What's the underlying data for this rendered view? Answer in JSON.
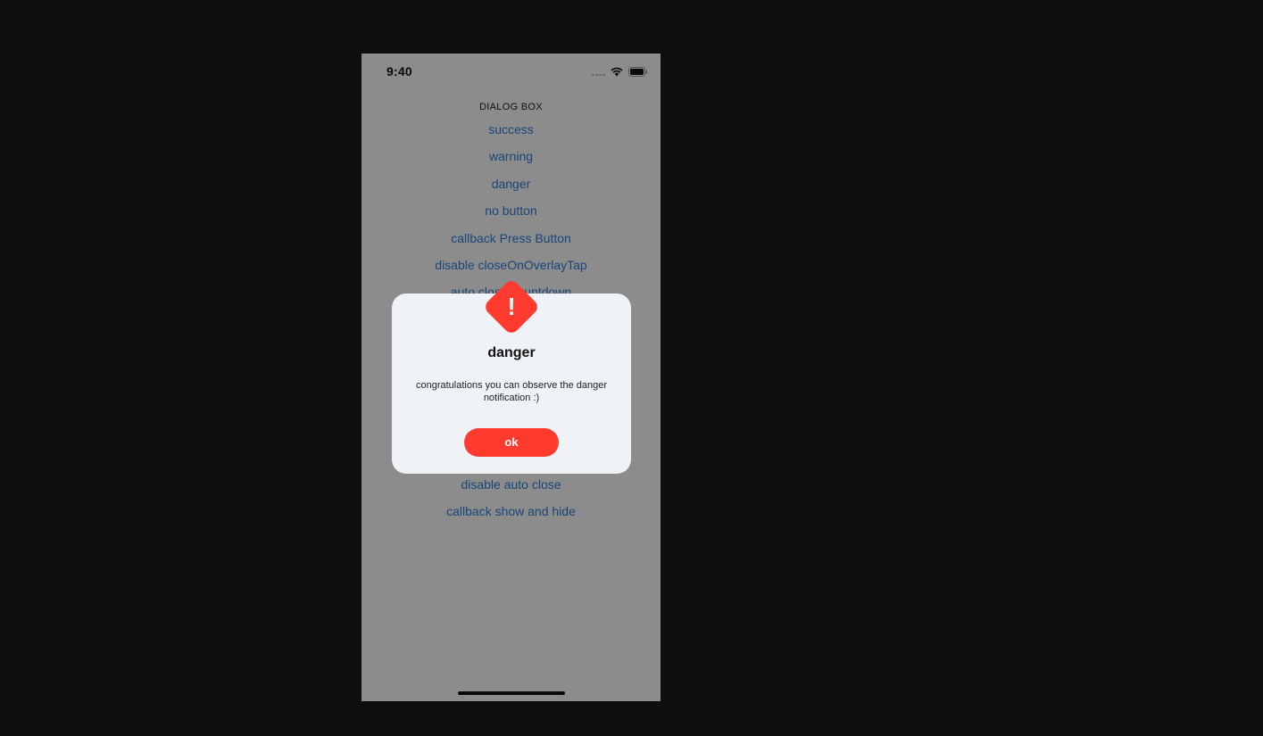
{
  "status_bar": {
    "time": "9:40",
    "icons": [
      "signal-icon",
      "wifi-icon",
      "battery-icon"
    ]
  },
  "screen": {
    "section_title": "DIALOG BOX",
    "menu_items_top": [
      "success",
      "warning",
      "danger",
      "no button",
      "callback Press Button",
      "disable closeOnOverlayTap",
      "auto close countdown"
    ],
    "menu_items_bottom": [
      "disable auto close",
      "callback show and hide"
    ],
    "link_color": "#2f7fdb"
  },
  "dialog": {
    "icon": "exclamation-diamond-icon",
    "icon_glyph": "!",
    "title": "danger",
    "message": "congratulations you can observe the danger notification :)",
    "button_label": "ok",
    "accent_color": "#ff3b30",
    "background_color": "#eff2f7"
  },
  "colors": {
    "page_background": "#0e0e0e",
    "overlay": "rgba(0,0,0,0.45)"
  }
}
